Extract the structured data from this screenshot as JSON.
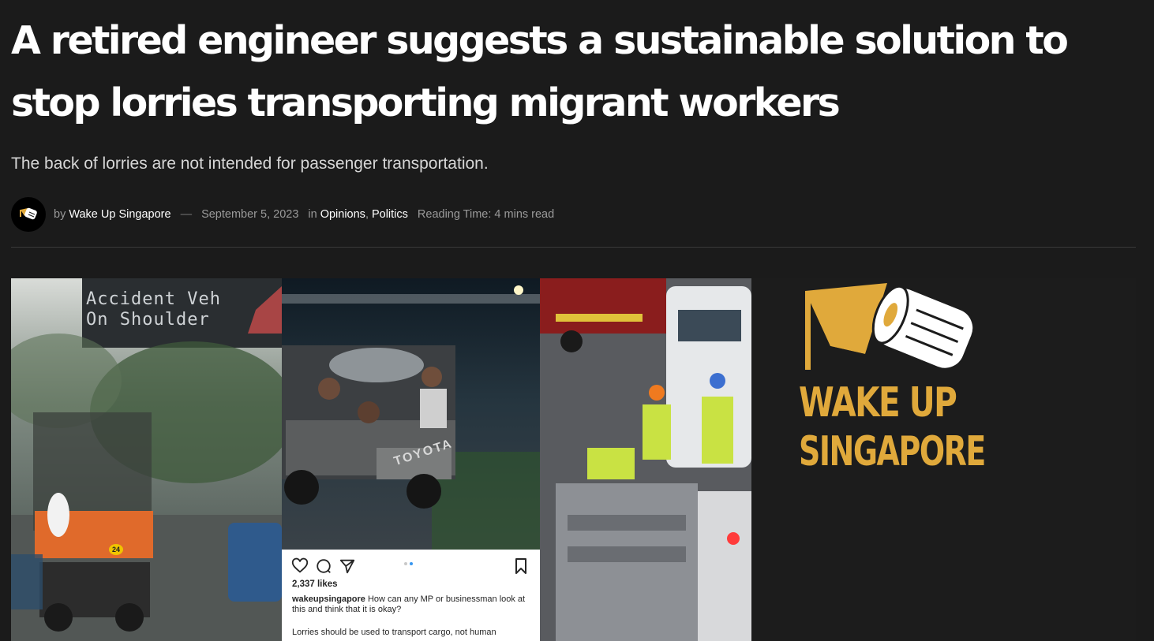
{
  "article": {
    "title": "A retired engineer suggests a sustainable solution to stop lorries transporting migrant workers",
    "subtitle": "The back of lorries are not intended for passenger transportation.",
    "meta": {
      "by": "by",
      "author": "Wake Up Singapore",
      "separator": "—",
      "date": "September 5, 2023",
      "in": "in",
      "category_1": "Opinions",
      "comma": ",",
      "category_2": "Politics",
      "reading_time": "Reading Time: 4 mins read"
    }
  },
  "hero": {
    "panel1": {
      "sign_line1": "Accident Veh",
      "sign_line2": "On Shoulder",
      "badge": "24"
    },
    "panel2": {
      "truck_brand": "TOYOTA",
      "instagram": {
        "likes": "2,337 likes",
        "username": "wakeupsingapore",
        "caption": "How can any MP or businessman look at this and think that it is okay?",
        "caption_line2": "Lorries should be used to transport cargo, not human"
      }
    },
    "logo": {
      "line1": "WAKE UP",
      "line2": "SINGAPORE"
    }
  },
  "colors": {
    "background": "#1b1b1b",
    "brand_gold": "#e0a93b",
    "divider": "#3a3a3a",
    "instagram_blue": "#3897f0"
  }
}
